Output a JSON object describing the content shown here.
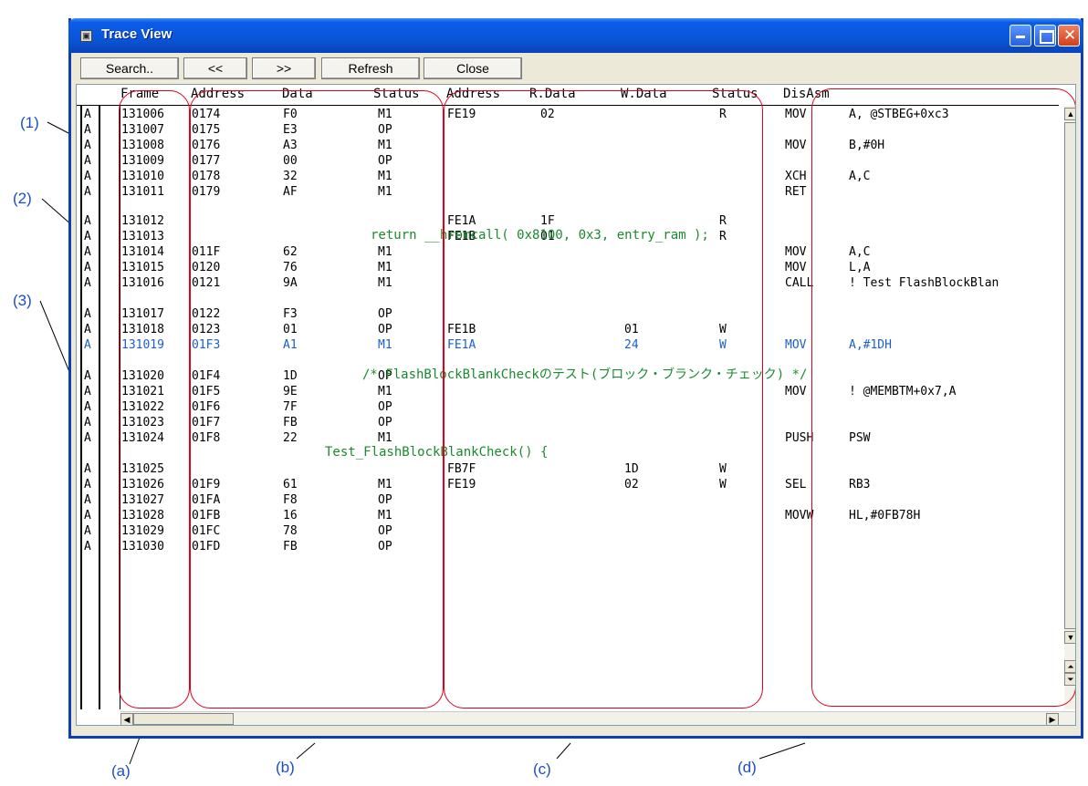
{
  "callouts": {
    "c1": "(1)",
    "c2": "(2)",
    "c3": "(3)",
    "ca": "(a)",
    "cb": "(b)",
    "cc": "(c)",
    "cd": "(d)"
  },
  "window": {
    "title": "Trace View",
    "controls": {
      "minimize_icon": "minimize-icon",
      "maximize_icon": "maximize-icon",
      "close_icon": "close-icon"
    }
  },
  "toolbar": {
    "search_label": "Search..",
    "prev_label": "<<",
    "next_label": ">>",
    "refresh_label": "Refresh",
    "close_label": "Close"
  },
  "columns": {
    "frame": "Frame",
    "address": "Address",
    "data": "Data",
    "status": "Status",
    "address2": "Address",
    "rdata": "R.Data",
    "wdata": "W.Data",
    "status2": "Status",
    "disasm": "DisAsm"
  },
  "colors": {
    "highlight_row": "#1d5fc8",
    "source_line": "#1b8a2e",
    "region_box": "#e0001c",
    "titlebar": "#0a55d8"
  },
  "rows": [
    {
      "mark": "A",
      "frame": "131006",
      "addr": "0174",
      "data": "F0",
      "status": "M1",
      "addr2": "FE19",
      "rdata": "02",
      "wdata": "",
      "status2": "R",
      "mnem": "MOV",
      "ops": "A, @STBEG+0xc3"
    },
    {
      "mark": "A",
      "frame": "131007",
      "addr": "0175",
      "data": "E3",
      "status": "OP",
      "addr2": "",
      "rdata": "",
      "wdata": "",
      "status2": "",
      "mnem": "",
      "ops": ""
    },
    {
      "mark": "A",
      "frame": "131008",
      "addr": "0176",
      "data": "A3",
      "status": "M1",
      "addr2": "",
      "rdata": "",
      "wdata": "",
      "status2": "",
      "mnem": "MOV",
      "ops": "B,#0H"
    },
    {
      "mark": "A",
      "frame": "131009",
      "addr": "0177",
      "data": "00",
      "status": "OP",
      "addr2": "",
      "rdata": "",
      "wdata": "",
      "status2": "",
      "mnem": "",
      "ops": ""
    },
    {
      "mark": "A",
      "frame": "131010",
      "addr": "0178",
      "data": "32",
      "status": "M1",
      "addr2": "",
      "rdata": "",
      "wdata": "",
      "status2": "",
      "mnem": "XCH",
      "ops": "A,C"
    },
    {
      "mark": "A",
      "frame": "131011",
      "addr": "0179",
      "data": "AF",
      "status": "M1",
      "addr2": "",
      "rdata": "",
      "wdata": "",
      "status2": "",
      "mnem": "RET",
      "ops": ""
    },
    {
      "mark": "A",
      "frame": "131012",
      "addr": "",
      "data": "",
      "status": "",
      "addr2": "FE1A",
      "rdata": "1F",
      "wdata": "",
      "status2": "R",
      "mnem": "",
      "ops": ""
    },
    {
      "mark": "A",
      "frame": "131013",
      "addr": "",
      "data": "",
      "status": "",
      "addr2": "FE1B",
      "rdata": "01",
      "wdata": "",
      "status2": "R",
      "mnem": "",
      "ops": ""
    },
    {
      "mark": "A",
      "frame": "131014",
      "addr": "011F",
      "data": "62",
      "status": "M1",
      "addr2": "",
      "rdata": "",
      "wdata": "",
      "status2": "",
      "mnem": "MOV",
      "ops": "A,C"
    },
    {
      "mark": "A",
      "frame": "131015",
      "addr": "0120",
      "data": "76",
      "status": "M1",
      "addr2": "",
      "rdata": "",
      "wdata": "",
      "status2": "",
      "mnem": "MOV",
      "ops": "L,A"
    },
    {
      "mark": "A",
      "frame": "131016",
      "addr": "0121",
      "data": "9A",
      "status": "M1",
      "addr2": "",
      "rdata": "",
      "wdata": "",
      "status2": "",
      "mnem": "CALL",
      "ops": "! Test FlashBlockBlan"
    },
    {
      "mark": "A",
      "frame": "131017",
      "addr": "0122",
      "data": "F3",
      "status": "OP",
      "addr2": "",
      "rdata": "",
      "wdata": "",
      "status2": "",
      "mnem": "",
      "ops": ""
    },
    {
      "mark": "A",
      "frame": "131018",
      "addr": "0123",
      "data": "01",
      "status": "OP",
      "addr2": "FE1B",
      "rdata": "",
      "wdata": "01",
      "status2": "W",
      "mnem": "",
      "ops": ""
    },
    {
      "mark": "A",
      "frame": "131019",
      "addr": "01F3",
      "data": "A1",
      "status": "M1",
      "addr2": "FE1A",
      "rdata": "",
      "wdata": "24",
      "status2": "W",
      "mnem": "MOV",
      "ops": "A,#1DH",
      "hl": true
    },
    {
      "mark": "A",
      "frame": "131020",
      "addr": "01F4",
      "data": "1D",
      "status": "OP",
      "addr2": "",
      "rdata": "",
      "wdata": "",
      "status2": "",
      "mnem": "",
      "ops": ""
    },
    {
      "mark": "A",
      "frame": "131021",
      "addr": "01F5",
      "data": "9E",
      "status": "M1",
      "addr2": "",
      "rdata": "",
      "wdata": "",
      "status2": "",
      "mnem": "MOV",
      "ops": "! @MEMBTM+0x7,A"
    },
    {
      "mark": "A",
      "frame": "131022",
      "addr": "01F6",
      "data": "7F",
      "status": "OP",
      "addr2": "",
      "rdata": "",
      "wdata": "",
      "status2": "",
      "mnem": "",
      "ops": ""
    },
    {
      "mark": "A",
      "frame": "131023",
      "addr": "01F7",
      "data": "FB",
      "status": "OP",
      "addr2": "",
      "rdata": "",
      "wdata": "",
      "status2": "",
      "mnem": "",
      "ops": ""
    },
    {
      "mark": "A",
      "frame": "131024",
      "addr": "01F8",
      "data": "22",
      "status": "M1",
      "addr2": "",
      "rdata": "",
      "wdata": "",
      "status2": "",
      "mnem": "PUSH",
      "ops": "PSW"
    },
    {
      "mark": "A",
      "frame": "131025",
      "addr": "",
      "data": "",
      "status": "",
      "addr2": "FB7F",
      "rdata": "",
      "wdata": "1D",
      "status2": "W",
      "mnem": "",
      "ops": ""
    },
    {
      "mark": "A",
      "frame": "131026",
      "addr": "01F9",
      "data": "61",
      "status": "M1",
      "addr2": "FE19",
      "rdata": "",
      "wdata": "02",
      "status2": "W",
      "mnem": "SEL",
      "ops": "RB3"
    },
    {
      "mark": "A",
      "frame": "131027",
      "addr": "01FA",
      "data": "F8",
      "status": "OP",
      "addr2": "",
      "rdata": "",
      "wdata": "",
      "status2": "",
      "mnem": "",
      "ops": ""
    },
    {
      "mark": "A",
      "frame": "131028",
      "addr": "01FB",
      "data": "16",
      "status": "M1",
      "addr2": "",
      "rdata": "",
      "wdata": "",
      "status2": "",
      "mnem": "MOVW",
      "ops": "HL,#0FB78H"
    },
    {
      "mark": "A",
      "frame": "131029",
      "addr": "01FC",
      "data": "78",
      "status": "OP",
      "addr2": "",
      "rdata": "",
      "wdata": "",
      "status2": "",
      "mnem": "",
      "ops": ""
    },
    {
      "mark": "A",
      "frame": "131030",
      "addr": "01FD",
      "data": "FB",
      "status": "OP",
      "addr2": "",
      "rdata": "",
      "wdata": "",
      "status2": "",
      "mnem": "",
      "ops": ""
    }
  ],
  "source_lines": [
    "return __hromcall( 0x8100, 0x3, entry_ram );",
    "/* FlashBlockBlankCheckのテスト(ブロック・ブランク・チェック) */",
    "Test_FlashBlockBlankCheck() {"
  ],
  "scrollbar": {
    "up_icon": "scroll-up-icon",
    "down_icon": "scroll-down-icon",
    "left_icon": "scroll-left-icon",
    "right_icon": "scroll-right-icon"
  }
}
